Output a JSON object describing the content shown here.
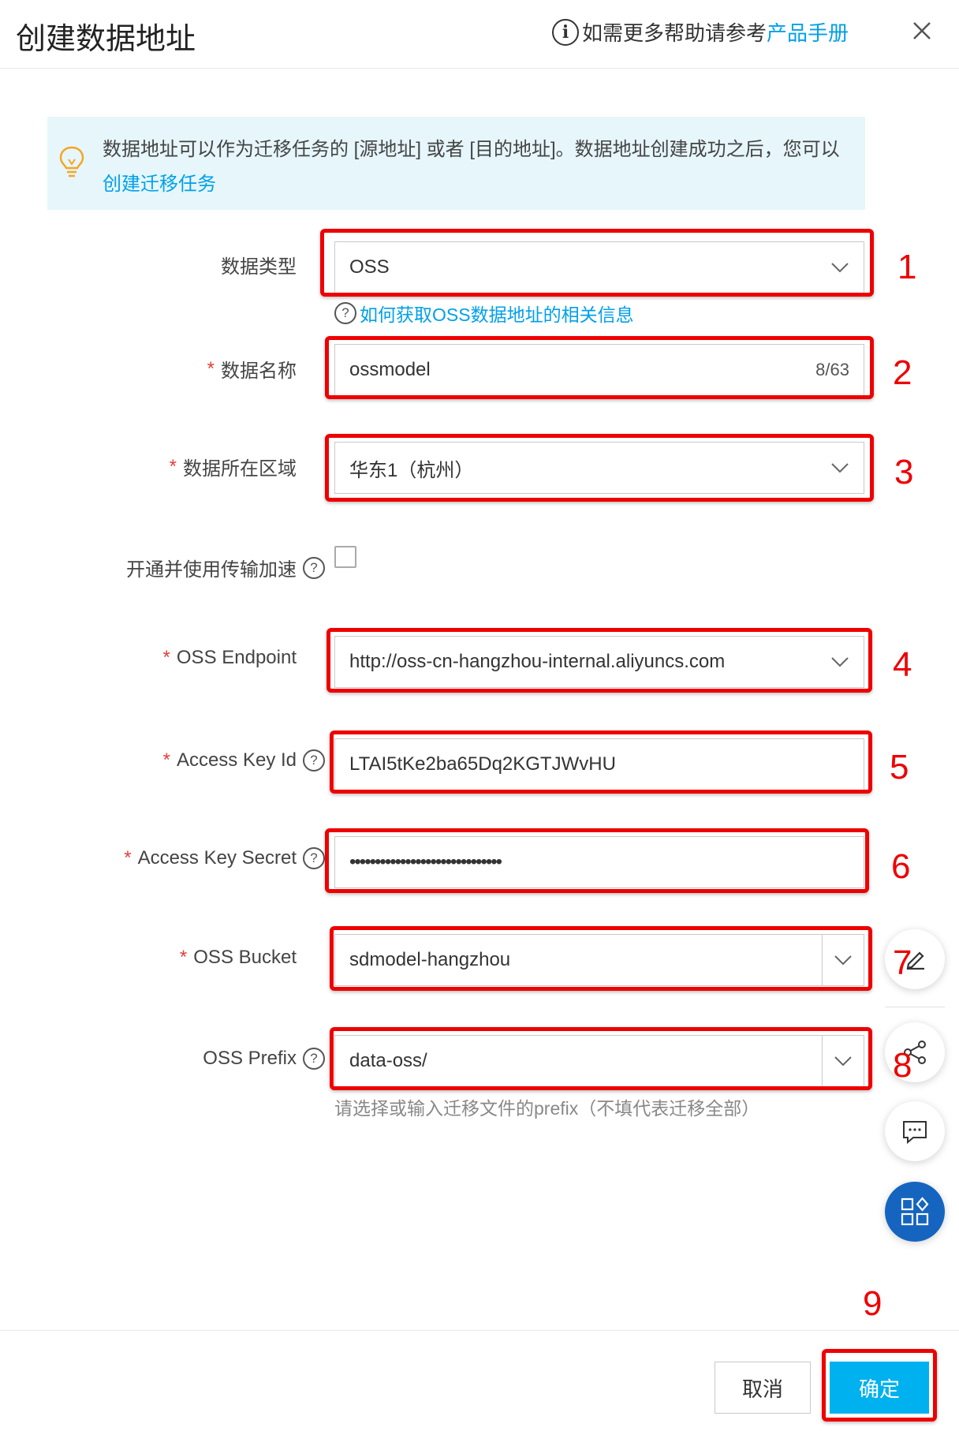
{
  "header": {
    "title": "创建数据地址",
    "help_prefix": "如需更多帮助请参考",
    "help_link": "产品手册"
  },
  "banner": {
    "text": "数据地址可以作为迁移任务的 [源地址] 或者 [目的地址]。数据地址创建成功之后，您可以",
    "link": "创建迁移任务"
  },
  "form": {
    "data_type": {
      "label": "数据类型",
      "value": "OSS",
      "help_link": "如何获取OSS数据地址的相关信息"
    },
    "data_name": {
      "label": "数据名称",
      "value": "ossmodel",
      "counter": "8/63"
    },
    "region": {
      "label": "数据所在区域",
      "value": "华东1（杭州）"
    },
    "acceleration": {
      "label": "开通并使用传输加速",
      "checked": false
    },
    "endpoint": {
      "label": "OSS Endpoint",
      "value": "http://oss-cn-hangzhou-internal.aliyuncs.com"
    },
    "access_key_id": {
      "label": "Access Key Id",
      "value": "LTAI5tKe2ba65Dq2KGTJWvHU"
    },
    "access_key_secret": {
      "label": "Access Key Secret",
      "value": "••••••••••••••••••••••••••••••"
    },
    "bucket": {
      "label": "OSS Bucket",
      "value": "sdmodel-hangzhou"
    },
    "prefix": {
      "label": "OSS Prefix",
      "value": "data-oss/",
      "hint": "请选择或输入迁移文件的prefix（不填代表迁移全部）"
    }
  },
  "required_mark": "*",
  "annotations": [
    "1",
    "2",
    "3",
    "4",
    "5",
    "6",
    "7",
    "8",
    "9"
  ],
  "footer": {
    "cancel_label": "取消",
    "ok_label": "确定"
  },
  "colors": {
    "accent": "#00a0e9",
    "primary_button": "#00b1f0",
    "annotation_red": "#e00000",
    "banner_bg": "#e6f6fb",
    "fab_blue": "#1565c0"
  },
  "icons": [
    "info-icon",
    "close-icon",
    "lightbulb-icon",
    "chevron-down-icon",
    "question-icon",
    "edit-icon",
    "share-icon",
    "feedback-icon",
    "apps-icon"
  ]
}
